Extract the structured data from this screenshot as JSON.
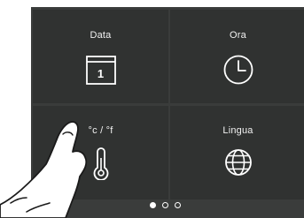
{
  "tiles": [
    {
      "label": "Data",
      "icon": "calendar-icon",
      "calendar_day": "1"
    },
    {
      "label": "Ora",
      "icon": "clock-icon"
    },
    {
      "label": "°c / °f",
      "icon": "thermometer-icon"
    },
    {
      "label": "Lingua",
      "icon": "globe-icon"
    }
  ],
  "pagination": {
    "pages": 3,
    "current": 1
  },
  "colors": {
    "screen_bg": "#3a3c3b",
    "tile_bg": "#303231",
    "foreground": "#ffffff"
  }
}
